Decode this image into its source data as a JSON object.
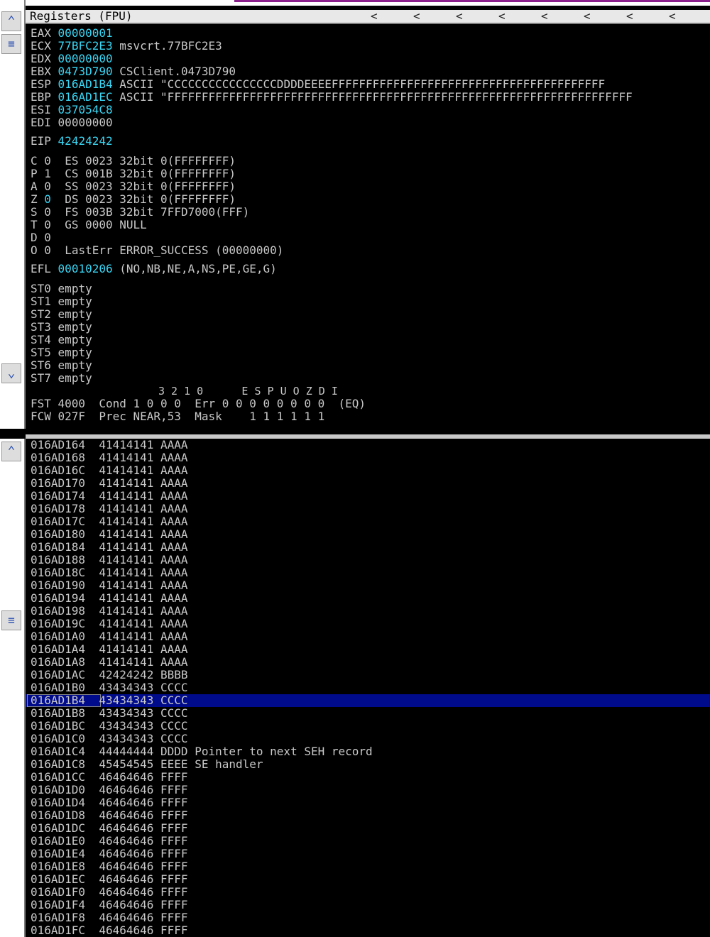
{
  "pane": {
    "title": "Registers (FPU)",
    "chevron": "<"
  },
  "registers": [
    {
      "name": "EAX",
      "value": "00000001",
      "comment": ""
    },
    {
      "name": "ECX",
      "value": "77BFC2E3",
      "comment": "msvcrt.77BFC2E3"
    },
    {
      "name": "EDX",
      "value": "00000000",
      "comment": ""
    },
    {
      "name": "EBX",
      "value": "0473D790",
      "comment": "CSClient.0473D790"
    },
    {
      "name": "ESP",
      "value": "016AD1B4",
      "comment": "ASCII \"CCCCCCCCCCCCCCCCDDDDEEEEFFFFFFFFFFFFFFFFFFFFFFFFFFFFFFFFFFFFFFFF"
    },
    {
      "name": "EBP",
      "value": "016AD1EC",
      "comment": "ASCII \"FFFFFFFFFFFFFFFFFFFFFFFFFFFFFFFFFFFFFFFFFFFFFFFFFFFFFFFFFFFFFFFFFFFF"
    },
    {
      "name": "ESI",
      "value": "037054C8",
      "comment": ""
    },
    {
      "name": "EDI",
      "value": "00000000",
      "comment": ""
    }
  ],
  "eip": {
    "name": "EIP",
    "value": "42424242"
  },
  "flags": [
    {
      "flag": "C",
      "val": "0",
      "seg": "ES 0023 32bit 0(FFFFFFFF)"
    },
    {
      "flag": "P",
      "val": "1",
      "seg": "CS 001B 32bit 0(FFFFFFFF)"
    },
    {
      "flag": "A",
      "val": "0",
      "seg": "SS 0023 32bit 0(FFFFFFFF)"
    },
    {
      "flag": "Z",
      "val": "0",
      "seg": "DS 0023 32bit 0(FFFFFFFF)"
    },
    {
      "flag": "S",
      "val": "0",
      "seg": "FS 003B 32bit 7FFD7000(FFF)"
    },
    {
      "flag": "T",
      "val": "0",
      "seg": "GS 0000 NULL"
    },
    {
      "flag": "D",
      "val": "0",
      "seg": ""
    },
    {
      "flag": "O",
      "val": "0",
      "seg": "LastErr ERROR_SUCCESS (00000000)"
    }
  ],
  "efl": {
    "name": "EFL",
    "value": "00010206",
    "comment": "(NO,NB,NE,A,NS,PE,GE,G)"
  },
  "st": [
    {
      "name": "ST0",
      "value": "empty"
    },
    {
      "name": "ST1",
      "value": "empty"
    },
    {
      "name": "ST2",
      "value": "empty"
    },
    {
      "name": "ST3",
      "value": "empty"
    },
    {
      "name": "ST4",
      "value": "empty"
    },
    {
      "name": "ST5",
      "value": "empty"
    },
    {
      "name": "ST6",
      "value": "empty"
    },
    {
      "name": "ST7",
      "value": "empty"
    }
  ],
  "fpu": {
    "header_line": "3 2 1 0      E S P U O Z D I",
    "fst_line": "FST 4000  Cond 1 0 0 0  Err 0 0 0 0 0 0 0 0  (EQ)",
    "fcw_line": "FCW 027F  Prec NEAR,53  Mask    1 1 1 1 1 1"
  },
  "stack": [
    {
      "addr": "016AD164",
      "val": "41414141",
      "ascii": "AAAA",
      "comment": ""
    },
    {
      "addr": "016AD168",
      "val": "41414141",
      "ascii": "AAAA",
      "comment": ""
    },
    {
      "addr": "016AD16C",
      "val": "41414141",
      "ascii": "AAAA",
      "comment": ""
    },
    {
      "addr": "016AD170",
      "val": "41414141",
      "ascii": "AAAA",
      "comment": ""
    },
    {
      "addr": "016AD174",
      "val": "41414141",
      "ascii": "AAAA",
      "comment": ""
    },
    {
      "addr": "016AD178",
      "val": "41414141",
      "ascii": "AAAA",
      "comment": ""
    },
    {
      "addr": "016AD17C",
      "val": "41414141",
      "ascii": "AAAA",
      "comment": ""
    },
    {
      "addr": "016AD180",
      "val": "41414141",
      "ascii": "AAAA",
      "comment": ""
    },
    {
      "addr": "016AD184",
      "val": "41414141",
      "ascii": "AAAA",
      "comment": ""
    },
    {
      "addr": "016AD188",
      "val": "41414141",
      "ascii": "AAAA",
      "comment": ""
    },
    {
      "addr": "016AD18C",
      "val": "41414141",
      "ascii": "AAAA",
      "comment": ""
    },
    {
      "addr": "016AD190",
      "val": "41414141",
      "ascii": "AAAA",
      "comment": ""
    },
    {
      "addr": "016AD194",
      "val": "41414141",
      "ascii": "AAAA",
      "comment": ""
    },
    {
      "addr": "016AD198",
      "val": "41414141",
      "ascii": "AAAA",
      "comment": ""
    },
    {
      "addr": "016AD19C",
      "val": "41414141",
      "ascii": "AAAA",
      "comment": ""
    },
    {
      "addr": "016AD1A0",
      "val": "41414141",
      "ascii": "AAAA",
      "comment": ""
    },
    {
      "addr": "016AD1A4",
      "val": "41414141",
      "ascii": "AAAA",
      "comment": ""
    },
    {
      "addr": "016AD1A8",
      "val": "41414141",
      "ascii": "AAAA",
      "comment": ""
    },
    {
      "addr": "016AD1AC",
      "val": "42424242",
      "ascii": "BBBB",
      "comment": ""
    },
    {
      "addr": "016AD1B0",
      "val": "43434343",
      "ascii": "CCCC",
      "comment": ""
    },
    {
      "addr": "016AD1B4",
      "val": "43434343",
      "ascii": "CCCC",
      "comment": "",
      "selected": true
    },
    {
      "addr": "016AD1B8",
      "val": "43434343",
      "ascii": "CCCC",
      "comment": ""
    },
    {
      "addr": "016AD1BC",
      "val": "43434343",
      "ascii": "CCCC",
      "comment": ""
    },
    {
      "addr": "016AD1C0",
      "val": "43434343",
      "ascii": "CCCC",
      "comment": ""
    },
    {
      "addr": "016AD1C4",
      "val": "44444444",
      "ascii": "DDDD",
      "comment": "Pointer to next SEH record"
    },
    {
      "addr": "016AD1C8",
      "val": "45454545",
      "ascii": "EEEE",
      "comment": "SE handler"
    },
    {
      "addr": "016AD1CC",
      "val": "46464646",
      "ascii": "FFFF",
      "comment": ""
    },
    {
      "addr": "016AD1D0",
      "val": "46464646",
      "ascii": "FFFF",
      "comment": ""
    },
    {
      "addr": "016AD1D4",
      "val": "46464646",
      "ascii": "FFFF",
      "comment": ""
    },
    {
      "addr": "016AD1D8",
      "val": "46464646",
      "ascii": "FFFF",
      "comment": ""
    },
    {
      "addr": "016AD1DC",
      "val": "46464646",
      "ascii": "FFFF",
      "comment": ""
    },
    {
      "addr": "016AD1E0",
      "val": "46464646",
      "ascii": "FFFF",
      "comment": ""
    },
    {
      "addr": "016AD1E4",
      "val": "46464646",
      "ascii": "FFFF",
      "comment": ""
    },
    {
      "addr": "016AD1E8",
      "val": "46464646",
      "ascii": "FFFF",
      "comment": ""
    },
    {
      "addr": "016AD1EC",
      "val": "46464646",
      "ascii": "FFFF",
      "comment": ""
    },
    {
      "addr": "016AD1F0",
      "val": "46464646",
      "ascii": "FFFF",
      "comment": ""
    },
    {
      "addr": "016AD1F4",
      "val": "46464646",
      "ascii": "FFFF",
      "comment": ""
    },
    {
      "addr": "016AD1F8",
      "val": "46464646",
      "ascii": "FFFF",
      "comment": ""
    },
    {
      "addr": "016AD1FC",
      "val": "46464646",
      "ascii": "FFFF",
      "comment": ""
    }
  ],
  "icons": {
    "scroll_up": "scroll-up-icon",
    "scroll_down": "scroll-down-icon",
    "scroll_thumb": "scroll-thumb-icon"
  },
  "colors": {
    "background": "#000000",
    "text": "#c8c8c8",
    "changed_register": "#39d7f5",
    "selection": "#000b8c"
  }
}
